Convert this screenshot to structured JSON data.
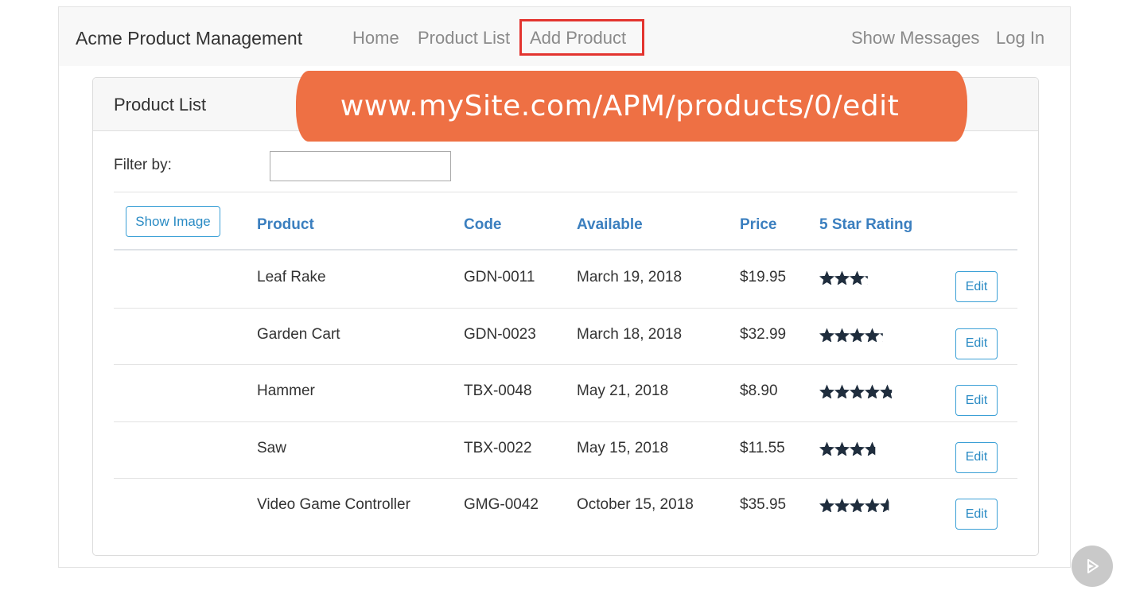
{
  "nav": {
    "brand": "Acme Product Management",
    "links": [
      "Home",
      "Product List",
      "Add Product"
    ],
    "right_links": [
      "Show Messages",
      "Log In"
    ],
    "highlighted": "Add Product"
  },
  "card": {
    "title": "Product List"
  },
  "filter": {
    "label": "Filter by:",
    "value": ""
  },
  "banner": {
    "text": "www.mySite.com/APM/products/0/edit",
    "color": "#ee7044"
  },
  "table": {
    "show_image_label": "Show Image",
    "headers": [
      "Product",
      "Code",
      "Available",
      "Price",
      "5 Star Rating"
    ],
    "edit_label": "Edit",
    "rows": [
      {
        "product": "Leaf Rake",
        "code": "GDN-0011",
        "available": "March 19, 2018",
        "price": "$19.95",
        "rating": 3.2
      },
      {
        "product": "Garden Cart",
        "code": "GDN-0023",
        "available": "March 18, 2018",
        "price": "$32.99",
        "rating": 4.2
      },
      {
        "product": "Hammer",
        "code": "TBX-0048",
        "available": "May 21, 2018",
        "price": "$8.90",
        "rating": 4.8
      },
      {
        "product": "Saw",
        "code": "TBX-0022",
        "available": "May 15, 2018",
        "price": "$11.55",
        "rating": 3.7
      },
      {
        "product": "Video Game Controller",
        "code": "GMG-0042",
        "available": "October 15, 2018",
        "price": "$35.95",
        "rating": 4.6
      }
    ]
  },
  "colors": {
    "accent": "#3b7fbf",
    "highlight_border": "#e3342f",
    "star": "#1f2d3d"
  },
  "icons": {
    "play": "play-icon",
    "star": "star-icon"
  }
}
